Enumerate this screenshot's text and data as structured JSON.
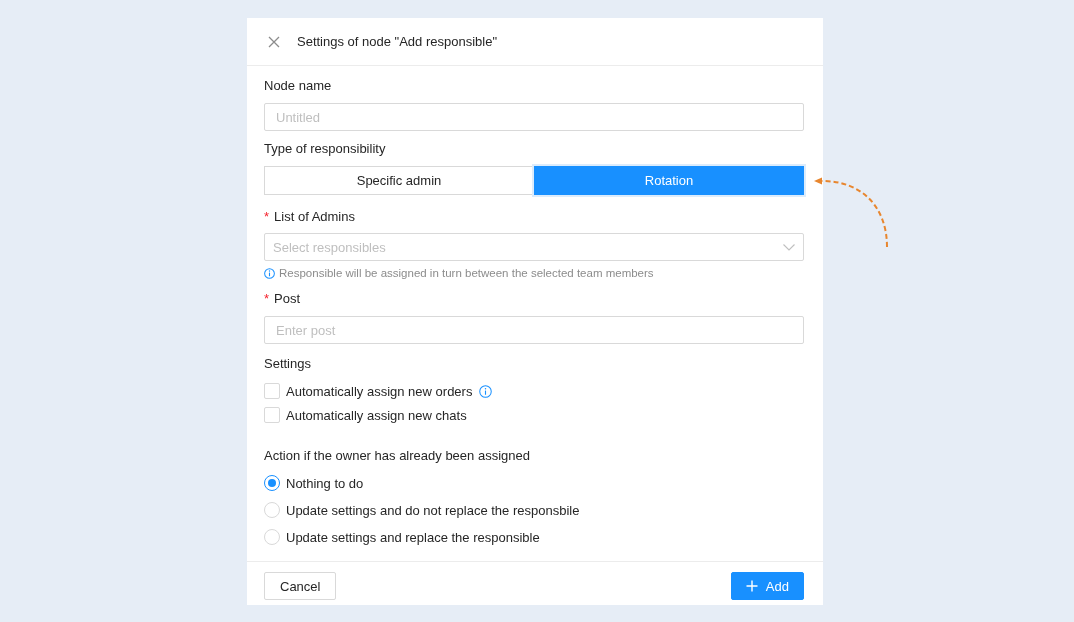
{
  "dialog": {
    "title": "Settings of node \"Add responsible\""
  },
  "node_name": {
    "label": "Node name",
    "placeholder": "Untitled"
  },
  "responsibility_type": {
    "label": "Type of responsibility",
    "options": [
      {
        "label": "Specific admin",
        "selected": false
      },
      {
        "label": "Rotation",
        "selected": true
      }
    ]
  },
  "admins": {
    "required_mark": "*",
    "label": "List of Admins",
    "placeholder": "Select responsibles",
    "hint": "Responsible will be assigned in turn between the selected team members"
  },
  "post": {
    "required_mark": "*",
    "label": "Post",
    "placeholder": "Enter post"
  },
  "settings": {
    "label": "Settings",
    "options": [
      {
        "label": "Automatically assign new orders",
        "checked": false,
        "info": true
      },
      {
        "label": "Automatically assign new chats",
        "checked": false,
        "info": false
      }
    ]
  },
  "action": {
    "label": "Action if the owner has already been assigned",
    "options": [
      {
        "label": "Nothing to do",
        "selected": true
      },
      {
        "label": "Update settings and do not replace the responsbile",
        "selected": false
      },
      {
        "label": "Update settings and replace the responsible",
        "selected": false
      }
    ]
  },
  "footer": {
    "buttons": [
      {
        "label": "Cancel",
        "kind": "secondary"
      },
      {
        "label": "Add",
        "kind": "primary"
      }
    ]
  }
}
